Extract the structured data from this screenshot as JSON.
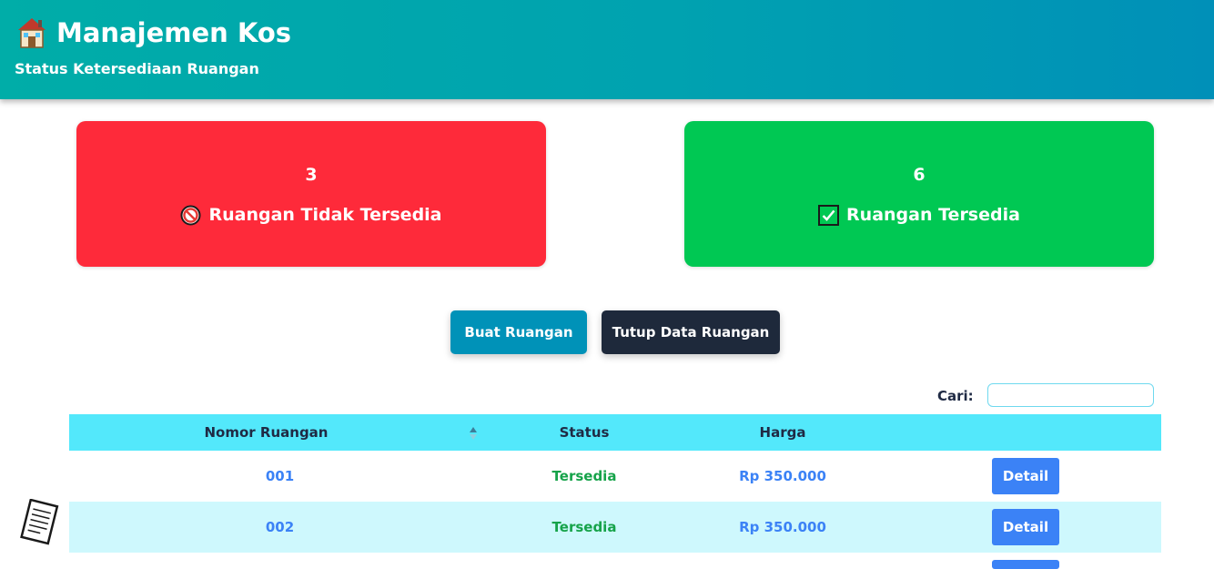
{
  "header": {
    "title": "Manajemen Kos",
    "subtitle": "Status Ketersediaan Ruangan",
    "icon": "house-icon"
  },
  "stats": {
    "unavailable": {
      "count": "3",
      "label": "Ruangan Tidak Tersedia",
      "icon": "no-entry-icon",
      "color": "#fe2a3a"
    },
    "available": {
      "count": "6",
      "label": "Ruangan Tersedia",
      "icon": "check-box-icon",
      "color": "#00c853"
    }
  },
  "actions": {
    "create_label": "Buat Ruangan",
    "close_label": "Tutup Data Ruangan"
  },
  "search": {
    "label": "Cari:",
    "value": "",
    "placeholder": ""
  },
  "table": {
    "columns": [
      "Nomor Ruangan",
      "Status",
      "Harga",
      ""
    ],
    "rows": [
      {
        "nomor": "001",
        "status": "Tersedia",
        "harga": "Rp 350.000",
        "action": "Detail"
      },
      {
        "nomor": "002",
        "status": "Tersedia",
        "harga": "Rp 350.000",
        "action": "Detail"
      }
    ]
  },
  "colors": {
    "header_start": "#00ada8",
    "header_end": "#0090b8",
    "table_header": "#53e8fb",
    "row_alt": "#cef8fd",
    "link_blue": "#3b82f6",
    "status_green": "#16a34a"
  }
}
